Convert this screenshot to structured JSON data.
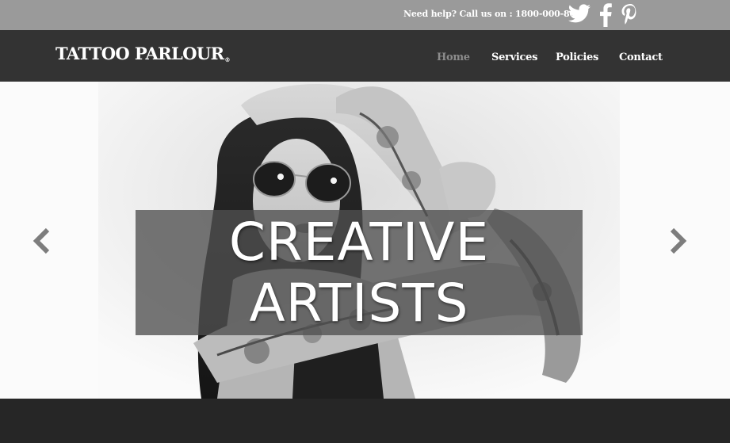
{
  "topbar": {
    "help_text": "Need help? Call us on : 1800-000-8080",
    "social_icons": [
      "twitter-icon",
      "facebook-icon",
      "pinterest-icon"
    ]
  },
  "header": {
    "logo_text": "TATTOO PARLOUR",
    "logo_mark": "®"
  },
  "nav": {
    "items": [
      {
        "label": "Home",
        "active": true
      },
      {
        "label": "Services",
        "active": false
      },
      {
        "label": "Policies",
        "active": false
      },
      {
        "label": "Contact",
        "active": false
      }
    ]
  },
  "hero": {
    "caption_line_1": "CREATIVE",
    "caption_line_2": "ARTISTS",
    "prev_icon": "chevron-left-icon",
    "next_icon": "chevron-right-icon"
  },
  "colors": {
    "topbar_bg": "#9a9a9a",
    "navbar_bg": "#333333",
    "active_nav": "#8c8c8c",
    "caption_bg": "#505050",
    "footer_bg": "#262626"
  }
}
